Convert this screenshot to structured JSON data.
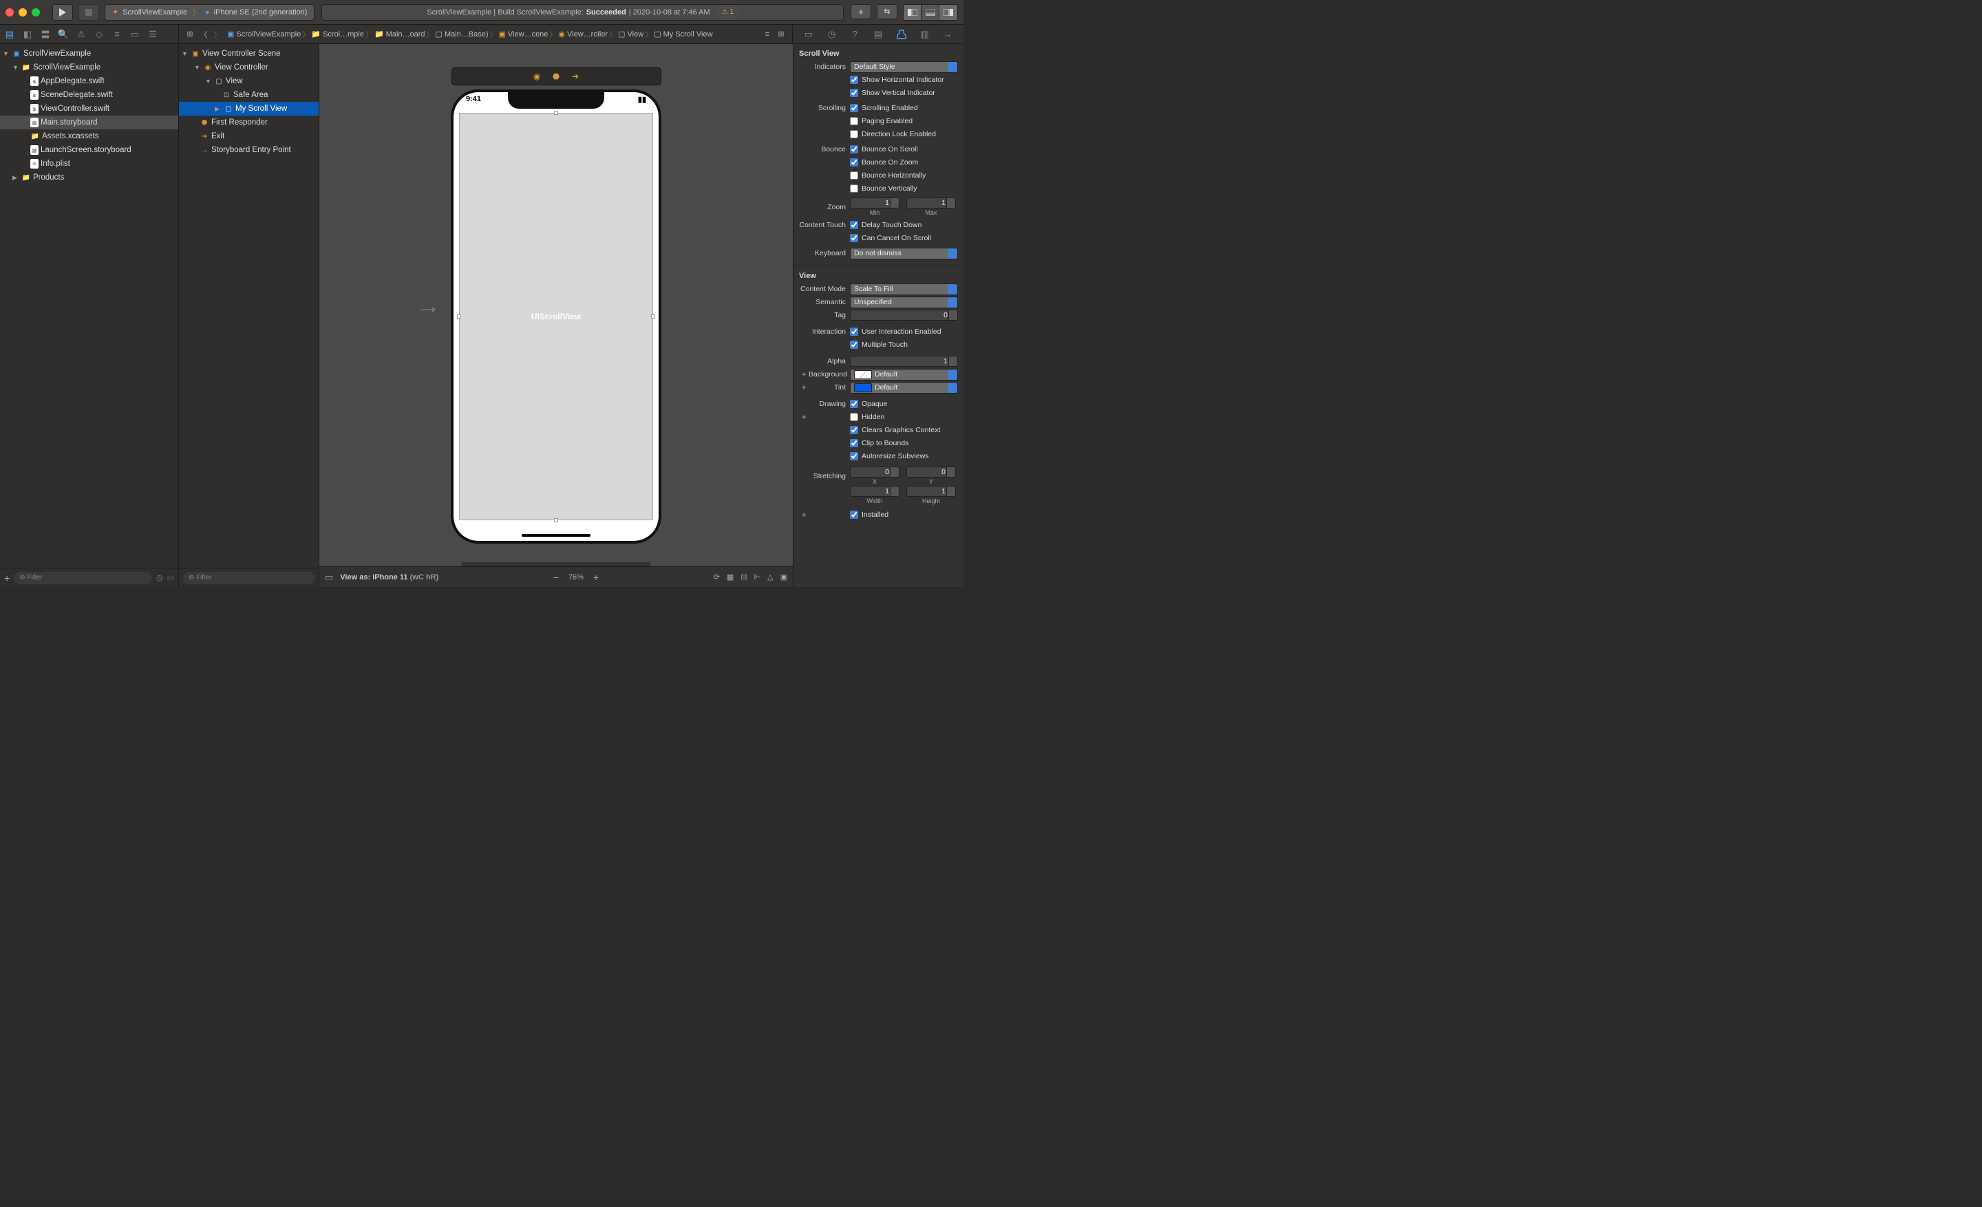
{
  "toolbar": {
    "scheme_project": "ScrollViewExample",
    "scheme_device": "iPhone SE (2nd generation)",
    "status_prefix": "ScrollViewExample | Build ScrollViewExample:",
    "status_result": "Succeeded",
    "status_time": "| 2020-10-08 at 7:46 AM",
    "warning_count": "1"
  },
  "breadcrumbs": [
    "ScrollViewExample",
    "Scrol…mple",
    "Main…oard",
    "Main…Base)",
    "View…cene",
    "View…roller",
    "View",
    "My Scroll View"
  ],
  "project_tree": {
    "root": "ScrollViewExample",
    "group": "ScrollViewExample",
    "files": [
      "AppDelegate.swift",
      "SceneDelegate.swift",
      "ViewController.swift",
      "Main.storyboard",
      "Assets.xcassets",
      "LaunchScreen.storyboard",
      "Info.plist"
    ],
    "products": "Products"
  },
  "outline": {
    "scene": "View Controller Scene",
    "vc": "View Controller",
    "view": "View",
    "safe": "Safe Area",
    "scroll": "My Scroll View",
    "responder": "First Responder",
    "exit": "Exit",
    "entry": "Storyboard Entry Point"
  },
  "canvas": {
    "clock": "9:41",
    "scrollview_label": "UIScrollView",
    "view_as_prefix": "View as:",
    "view_as_device": "iPhone 11",
    "view_as_traits": "(wC hR)",
    "zoom": "76%"
  },
  "inspector": {
    "scrollview_title": "Scroll View",
    "indicators_label": "Indicators",
    "indicators_value": "Default Style",
    "show_h": "Show Horizontal Indicator",
    "show_v": "Show Vertical Indicator",
    "scrolling_label": "Scrolling",
    "scroll_en": "Scrolling Enabled",
    "paging_en": "Paging Enabled",
    "dirlock": "Direction Lock Enabled",
    "bounce_label": "Bounce",
    "bounce_scroll": "Bounce On Scroll",
    "bounce_zoom": "Bounce On Zoom",
    "bounce_h": "Bounce Horizontally",
    "bounce_v": "Bounce Vertically",
    "zoom_label": "Zoom",
    "zoom_min": "1",
    "zoom_min_sub": "Min",
    "zoom_max": "1",
    "zoom_max_sub": "Max",
    "ctouch_label": "Content Touch",
    "delay_td": "Delay Touch Down",
    "cancel_scroll": "Can Cancel On Scroll",
    "keyboard_label": "Keyboard",
    "keyboard_value": "Do not dismiss",
    "view_title": "View",
    "cmode_label": "Content Mode",
    "cmode_value": "Scale To Fill",
    "semantic_label": "Semantic",
    "semantic_value": "Unspecified",
    "tag_label": "Tag",
    "tag_value": "0",
    "inter_label": "Interaction",
    "uie": "User Interaction Enabled",
    "mt": "Multiple Touch",
    "alpha_label": "Alpha",
    "alpha_value": "1",
    "bg_label": "Background",
    "bg_value": "Default",
    "tint_label": "Tint",
    "tint_value": "Default",
    "draw_label": "Drawing",
    "opaque": "Opaque",
    "hidden": "Hidden",
    "clears": "Clears Graphics Context",
    "clip": "Clip to Bounds",
    "autores": "Autoresize Subviews",
    "stretch_label": "Stretching",
    "sx": "0",
    "sx_sub": "X",
    "sy": "0",
    "sy_sub": "Y",
    "sw": "1",
    "sw_sub": "Width",
    "sh": "1",
    "sh_sub": "Height",
    "installed": "Installed"
  },
  "filter_placeholder": "Filter"
}
